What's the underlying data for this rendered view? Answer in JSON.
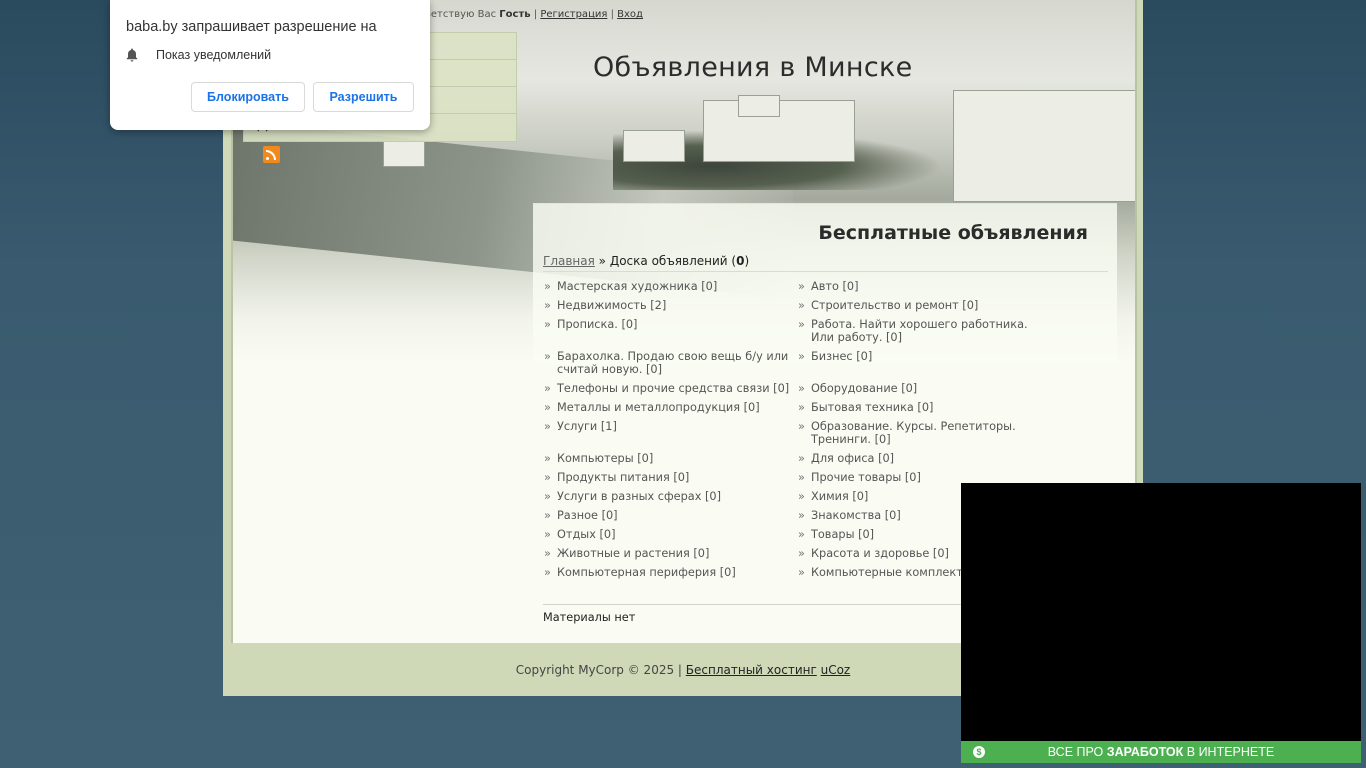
{
  "userbar": {
    "greeting": "ветствую Вас",
    "user": "Гость",
    "sep": "|",
    "register": "Регистрация",
    "login": "Вход"
  },
  "site": {
    "title": "Объявления в Минске",
    "nav_last": "Доска объявлений"
  },
  "notification": {
    "question": "baba.by запрашивает разрешение на",
    "permission": "Показ уведомлений",
    "block": "Блокировать",
    "allow": "Разрешить"
  },
  "content": {
    "title": "Бесплатные объявления",
    "breadcrumb": {
      "home": "Главная",
      "sep": "»",
      "current": "Доска объявлений (",
      "count": "0",
      "close": ")"
    },
    "categories": [
      "Мастерская художника [0]",
      "Авто [0]",
      "Недвижимость [2]",
      "Строительство и ремонт [0]",
      "Прописка. [0]",
      "Работа. Найти хорошего работника. Или работу. [0]",
      "Барахолка. Продаю свою вещь б/у или считай новую. [0]",
      "Бизнес [0]",
      "Телефоны и прочие средства связи [0]",
      "Оборудование [0]",
      "Металлы и металлопродукция [0]",
      "Бытовая техника [0]",
      "Услуги [1]",
      "Образование. Курсы. Репетиторы. Тренинги. [0]",
      "Компьютеры [0]",
      "Для офиса [0]",
      "Продукты питания [0]",
      "Прочие товары [0]",
      "Услуги в разных сферах [0]",
      "Химия [0]",
      "Разное [0]",
      "Знакомства [0]",
      "Отдых [0]",
      "Товары [0]",
      "Животные и растения [0]",
      "Красота и здоровье [0]",
      "Компьютерная периферия [0]",
      "Компьютерные комплектую"
    ],
    "no_materials": "Материалы нет"
  },
  "footer": {
    "copyright": "Copyright MyCorp © 2025 |",
    "hosting": "Бесплатный хостинг",
    "ucoz": "uCoz"
  },
  "ad": {
    "text_pre": "ВСЕ ПРО",
    "text_bold": "ЗАРАБОТОК",
    "text_post": "В ИНТЕРНЕТЕ",
    "coin": "$"
  },
  "colors": {
    "background": "#3a5b6f",
    "page_frame": "#cfd9b8",
    "content_bg": "#fafcf3",
    "ad_bar": "#4caf50",
    "button_text": "#1a73e8"
  }
}
